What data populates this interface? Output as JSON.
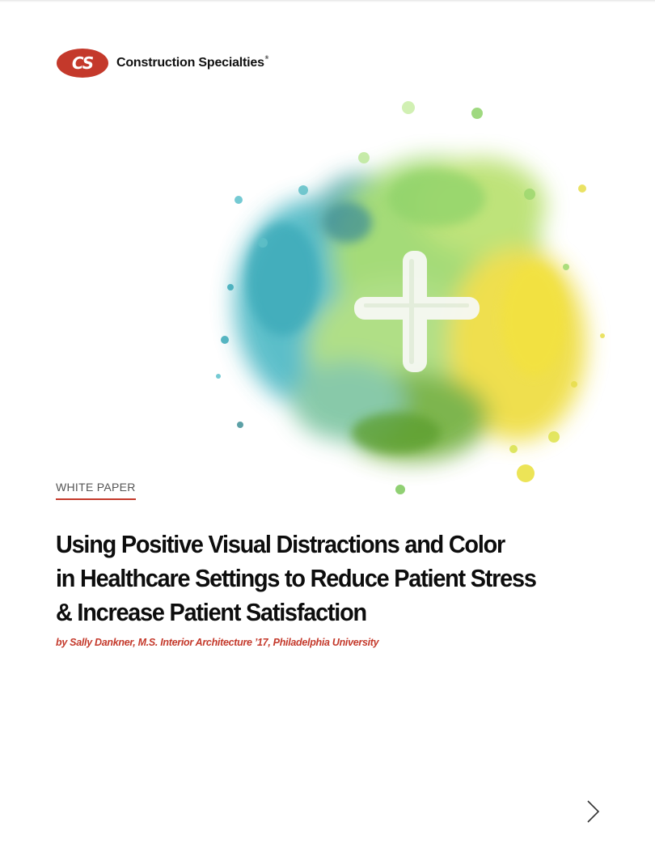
{
  "header": {
    "logo_mark": "CS",
    "brand_name": "Construction Specialties",
    "brand_reg": "®"
  },
  "cover": {
    "kicker": "WHITE PAPER",
    "title_lines": [
      "Using Positive Visual Distractions and Color",
      "in Healthcare Settings to Reduce Patient Stress",
      "& Increase Patient Satisfaction"
    ],
    "byline": "by Sally Dankner, M.S. Interior Architecture ’17, Philadelphia University",
    "illustration_icon": "watercolor-plus-icon"
  },
  "navigation": {
    "next_icon": "chevron-right-icon"
  },
  "colors": {
    "brand_red": "#c4392b",
    "splash_teal": "#3fb5c2",
    "splash_green": "#8fd06a",
    "splash_yellow": "#f0dc3a"
  }
}
